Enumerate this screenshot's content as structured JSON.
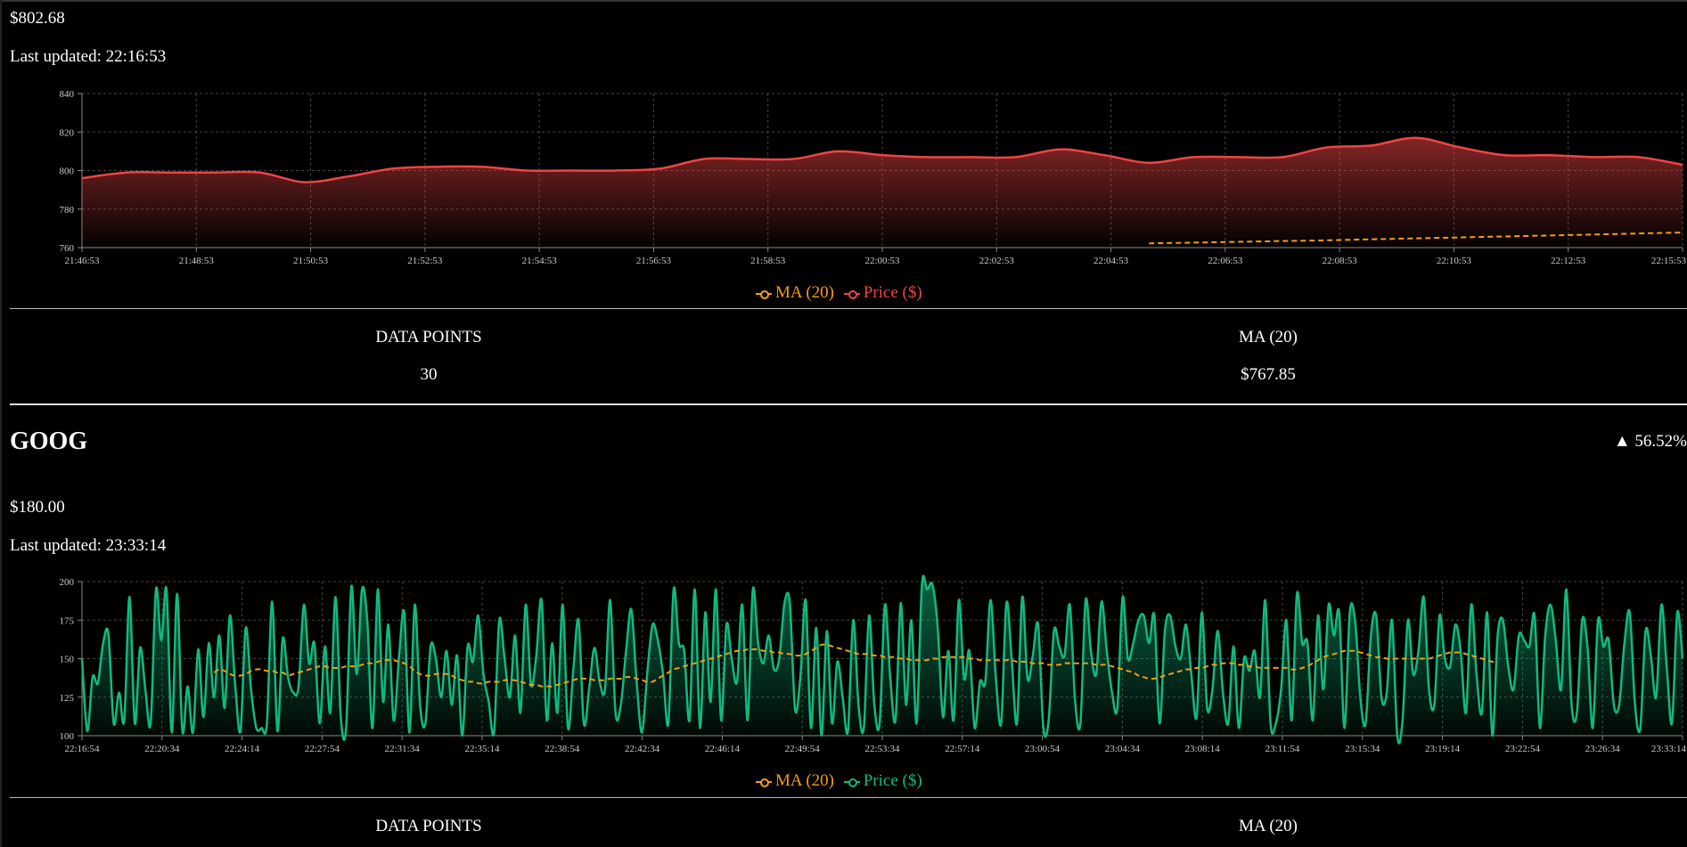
{
  "colors": {
    "ma": "#f59e0b",
    "up": "#10b981",
    "down": "#ef4444",
    "grid": "#444"
  },
  "stocks": [
    {
      "symbol": "",
      "price": "$802.68",
      "last_updated": "Last updated: 22:16:53",
      "change": "",
      "stats": {
        "data_points_label": "DATA POINTS",
        "data_points_value": "30",
        "ma_label": "MA (20)",
        "ma_value": "$767.85"
      },
      "legend": {
        "ma": "MA (20)",
        "price": "Price ($)"
      }
    },
    {
      "symbol": "GOOG",
      "price": "$180.00",
      "last_updated": "Last updated: 23:33:14",
      "change": "▲ 56.52%",
      "stats": {
        "data_points_label": "DATA POINTS",
        "ma_label": "MA (20)"
      },
      "legend": {
        "ma": "MA (20)",
        "price": "Price ($)"
      }
    }
  ],
  "chart_data": [
    {
      "type": "area",
      "series": [
        {
          "name": "Price ($)",
          "color": "#ef4444",
          "values": [
            796,
            799,
            799,
            799,
            799,
            794,
            797,
            801,
            802,
            802,
            800,
            800,
            800,
            801,
            806,
            806,
            806,
            810,
            808,
            807,
            807,
            807,
            811,
            808,
            804,
            807,
            807,
            807,
            812,
            813,
            817,
            812,
            808,
            808,
            807,
            807,
            803
          ]
        },
        {
          "name": "MA (20)",
          "color": "#f59e0b",
          "dashed": true,
          "values": [
            null,
            null,
            null,
            null,
            null,
            null,
            null,
            null,
            null,
            null,
            null,
            null,
            null,
            null,
            null,
            null,
            null,
            null,
            null,
            null,
            null,
            null,
            null,
            null,
            762.2,
            762.6,
            763.0,
            763.4,
            763.8,
            764.3,
            764.8,
            765.3,
            765.8,
            766.3,
            766.8,
            767.3,
            767.85
          ]
        }
      ],
      "ylim": [
        760,
        840
      ],
      "yticks": [
        760,
        780,
        800,
        820,
        840
      ],
      "xtick_labels": [
        "21:46:53",
        "21:48:53",
        "21:50:53",
        "21:52:53",
        "21:54:53",
        "21:56:53",
        "21:58:53",
        "22:00:53",
        "22:02:53",
        "22:04:53",
        "22:06:53",
        "22:08:53",
        "22:10:53",
        "22:12:53",
        "22:15:53"
      ],
      "grid": true,
      "legend_position": "bottom-center"
    },
    {
      "type": "area",
      "series": [
        {
          "name": "Price ($)",
          "color": "#10b981",
          "values": [
            150,
            103,
            138,
            134,
            160,
            166,
            108,
            128,
            110,
            190,
            108,
            157,
            130,
            108,
            195,
            162,
            195,
            102,
            192,
            103,
            132,
            102,
            156,
            112,
            160,
            125,
            165,
            118,
            178,
            133,
            103,
            170,
            130,
            105,
            105,
            108,
            187,
            103,
            163,
            138,
            128,
            132,
            185,
            147,
            160,
            108,
            158,
            115,
            190,
            112,
            105,
            197,
            140,
            195,
            175,
            105,
            195,
            122,
            172,
            110,
            150,
            180,
            102,
            185,
            120,
            108,
            158,
            150,
            125,
            155,
            120,
            152,
            100,
            158,
            148,
            178,
            140,
            122,
            102,
            175,
            150,
            125,
            165,
            115,
            185,
            133,
            152,
            188,
            110,
            160,
            115,
            185,
            105,
            142,
            175,
            108,
            130,
            157,
            135,
            130,
            188,
            115,
            120,
            155,
            182,
            135,
            102,
            140,
            172,
            162,
            140,
            108,
            195,
            160,
            155,
            110,
            195,
            105,
            180,
            122,
            195,
            110,
            172,
            150,
            135,
            185,
            110,
            195,
            160,
            147,
            165,
            143,
            150,
            186,
            186,
            117,
            138,
            188,
            105,
            170,
            100,
            168,
            108,
            148,
            125,
            103,
            175,
            120,
            105,
            178,
            120,
            108,
            185,
            138,
            110,
            186,
            120,
            175,
            108,
            198,
            195,
            198,
            170,
            112,
            155,
            110,
            188,
            137,
            155,
            105,
            135,
            135,
            188,
            138,
            108,
            186,
            150,
            108,
            190,
            137,
            152,
            172,
            105,
            110,
            168,
            158,
            152,
            185,
            123,
            108,
            188,
            155,
            140,
            187,
            155,
            128,
            118,
            190,
            150,
            160,
            175,
            178,
            160,
            178,
            108,
            168,
            178,
            158,
            150,
            172,
            140,
            112,
            180,
            118,
            130,
            168,
            128,
            108,
            158,
            105,
            150,
            142,
            155,
            125,
            188,
            108,
            108,
            130,
            175,
            110,
            192,
            160,
            160,
            110,
            178,
            130,
            185,
            165,
            180,
            105,
            180,
            175,
            125,
            108,
            165,
            178,
            125,
            128,
            175,
            100,
            110,
            175,
            140,
            155,
            190,
            130,
            120,
            178,
            150,
            145,
            172,
            155,
            115,
            185,
            140,
            115,
            180,
            100,
            165,
            175,
            145,
            130,
            165,
            162,
            158,
            178,
            105,
            165,
            185,
            162,
            130,
            195,
            120,
            115,
            175,
            158,
            105,
            175,
            158,
            162,
            120,
            120,
            160,
            180,
            120,
            105,
            168,
            152,
            125,
            185,
            145,
            108,
            180,
            150
          ],
          "note_x_extent": 300
        },
        {
          "name": "MA (20)",
          "color": "#f59e0b",
          "dashed": true,
          "values": [
            null,
            null,
            null,
            null,
            null,
            null,
            null,
            null,
            null,
            null,
            null,
            null,
            null,
            null,
            null,
            null,
            null,
            null,
            null,
            null,
            null,
            null,
            null,
            null,
            null,
            141,
            143,
            142,
            140,
            139,
            139,
            140,
            142,
            143,
            143,
            142,
            142,
            141,
            141,
            139,
            140,
            141,
            142,
            143,
            144,
            145,
            145,
            144,
            144,
            144,
            145,
            145,
            145,
            146,
            147,
            147,
            148,
            149,
            149,
            149,
            148,
            147,
            145,
            142,
            140,
            139,
            139,
            140,
            140,
            140,
            139,
            137,
            136,
            135,
            135,
            134,
            134,
            135,
            135,
            135,
            136,
            136,
            136,
            135,
            134,
            133,
            133,
            132,
            132,
            132,
            133,
            134,
            135,
            136,
            137,
            137,
            137,
            136,
            136,
            136,
            137,
            137,
            137,
            138,
            138,
            137,
            136,
            135,
            135,
            137,
            139,
            141,
            143,
            144,
            145,
            146,
            147,
            148,
            149,
            150,
            151,
            152,
            153,
            154,
            155,
            155,
            156,
            156,
            156,
            155,
            155,
            154,
            154,
            153,
            153,
            152,
            152,
            153,
            155,
            157,
            159,
            159,
            158,
            157,
            156,
            155,
            154,
            153,
            153,
            153,
            152,
            152,
            151,
            151,
            151,
            150,
            150,
            149,
            149,
            149,
            149,
            150,
            150,
            151,
            151,
            151,
            151,
            151,
            150,
            150,
            149,
            149,
            149,
            149,
            149,
            149,
            149,
            148,
            148,
            148,
            147,
            147,
            147,
            146,
            146,
            146,
            147,
            147,
            147,
            147,
            147,
            147,
            146,
            146,
            146,
            145,
            144,
            143,
            142,
            141,
            139,
            138,
            137,
            137,
            138,
            139,
            140,
            141,
            142,
            143,
            143,
            144,
            144,
            145,
            146,
            146,
            147,
            147,
            147,
            146,
            146,
            145,
            145,
            144,
            144,
            144,
            144,
            144,
            144,
            143,
            143,
            144,
            145,
            147,
            149,
            151,
            152,
            153,
            154,
            155,
            155,
            155,
            154,
            153,
            152,
            151,
            151,
            150,
            150,
            150,
            150,
            150,
            150,
            150,
            150,
            150,
            151,
            152,
            153,
            154,
            154,
            154,
            153,
            152,
            151,
            150,
            149,
            148,
            147
          ]
        }
      ],
      "ylim": [
        100,
        200
      ],
      "yticks": [
        100,
        125,
        150,
        175,
        200
      ],
      "xtick_labels": [
        "22:16:54",
        "22:20:34",
        "22:24:14",
        "22:27:54",
        "22:31:34",
        "22:35:14",
        "22:38:54",
        "22:42:34",
        "22:46:14",
        "22:49:54",
        "22:53:34",
        "22:57:14",
        "23:00:54",
        "23:04:34",
        "23:08:14",
        "23:11:54",
        "23:15:34",
        "23:19:14",
        "23:22:54",
        "23:26:34",
        "23:33:14"
      ],
      "grid": true,
      "legend_position": "bottom-center"
    }
  ]
}
